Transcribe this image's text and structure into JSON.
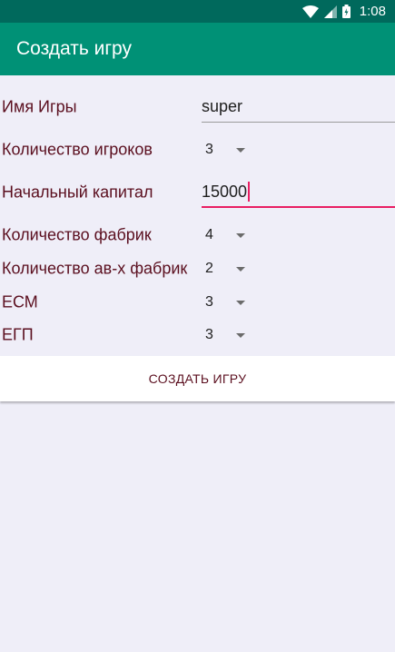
{
  "status_bar": {
    "time": "1:08",
    "icons": [
      "wifi-icon",
      "signal-icon",
      "battery-icon"
    ]
  },
  "app_bar": {
    "title": "Создать игру",
    "color": "#009176",
    "status_color": "#00695c"
  },
  "form": {
    "game_name": {
      "label": "Имя Игры",
      "value": "super"
    },
    "players": {
      "label": "Количество игроков",
      "value": "3"
    },
    "capital": {
      "label": "Начальный капитал",
      "value": "15000"
    },
    "factories": {
      "label": "Количество фабрик",
      "value": "4"
    },
    "auto_factories": {
      "label": "Количество ав-х фабрик",
      "value": "2"
    },
    "ecm": {
      "label": "ЕСМ",
      "value": "3"
    },
    "egp": {
      "label": "ЕГП",
      "value": "3"
    }
  },
  "actions": {
    "create_label": "СОЗДАТЬ ИГРУ"
  },
  "colors": {
    "label_text": "#5b0f1f",
    "focus_accent": "#e91e63",
    "background": "#efeef8"
  }
}
